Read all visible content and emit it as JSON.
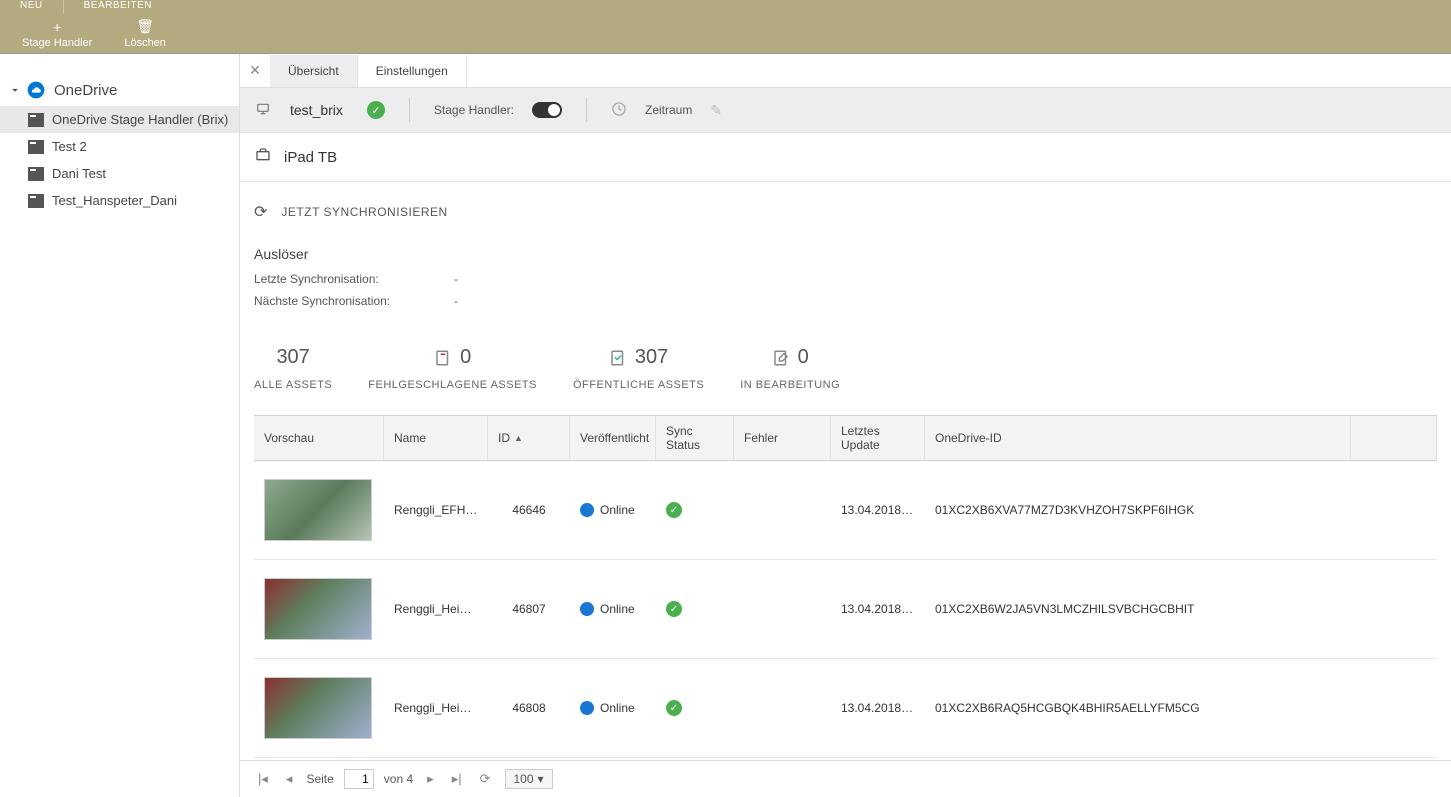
{
  "topbar": {
    "neu": "NEU",
    "bearbeiten": "BEARBEITEN"
  },
  "toolbar": {
    "stageHandler": "Stage Handler",
    "loeschen": "Löschen"
  },
  "sidebar": {
    "root": "OneDrive",
    "items": [
      {
        "label": "OneDrive Stage Handler (Brix)"
      },
      {
        "label": "Test 2"
      },
      {
        "label": "Dani Test"
      },
      {
        "label": "Test_Hanspeter_Dani"
      }
    ]
  },
  "tabs": {
    "overview": "Übersicht",
    "settings": "Einstellungen"
  },
  "infobar": {
    "name": "test_brix",
    "stageHandlerLabel": "Stage Handler:",
    "zeitraum": "Zeitraum"
  },
  "ipad": {
    "name": "iPad TB"
  },
  "sync": {
    "now": "JETZT SYNCHRONISIEREN",
    "triggerTitle": "Auslöser",
    "lastLabel": "Letzte Synchronisation:",
    "lastValue": "-",
    "nextLabel": "Nächste Synchronisation:",
    "nextValue": "-"
  },
  "stats": {
    "all": {
      "value": "307",
      "label": "ALLE ASSETS"
    },
    "failed": {
      "value": "0",
      "label": "FEHLGESCHLAGENE ASSETS"
    },
    "public": {
      "value": "307",
      "label": "ÖFFENTLICHE ASSETS"
    },
    "editing": {
      "value": "0",
      "label": "IN BEARBEITUNG"
    }
  },
  "table": {
    "headers": {
      "preview": "Vorschau",
      "name": "Name",
      "id": "ID",
      "published": "Veröffentlicht",
      "sync": "Sync Status",
      "error": "Fehler",
      "updated": "Letztes Update",
      "odid": "OneDrive-ID"
    },
    "rows": [
      {
        "name": "Renggli_EFH_...",
        "id": "46646",
        "published": "Online",
        "updated": "13.04.2018 0...",
        "odid": "01XC2XB6XVA77MZ7D3KVHZOH7SKPF6IHGK",
        "thumb": ""
      },
      {
        "name": "Renggli_Heim...",
        "id": "46807",
        "published": "Online",
        "updated": "13.04.2018 0...",
        "odid": "01XC2XB6W2JA5VN3LMCZHILSVBCHGCBHIT",
        "thumb": "red"
      },
      {
        "name": "Renggli_Heim...",
        "id": "46808",
        "published": "Online",
        "updated": "13.04.2018 0...",
        "odid": "01XC2XB6RAQ5HCGBQK4BHIR5AELLYFM5CG",
        "thumb": "red"
      }
    ]
  },
  "pager": {
    "pageLabel": "Seite",
    "page": "1",
    "of": "von 4",
    "size": "100"
  }
}
